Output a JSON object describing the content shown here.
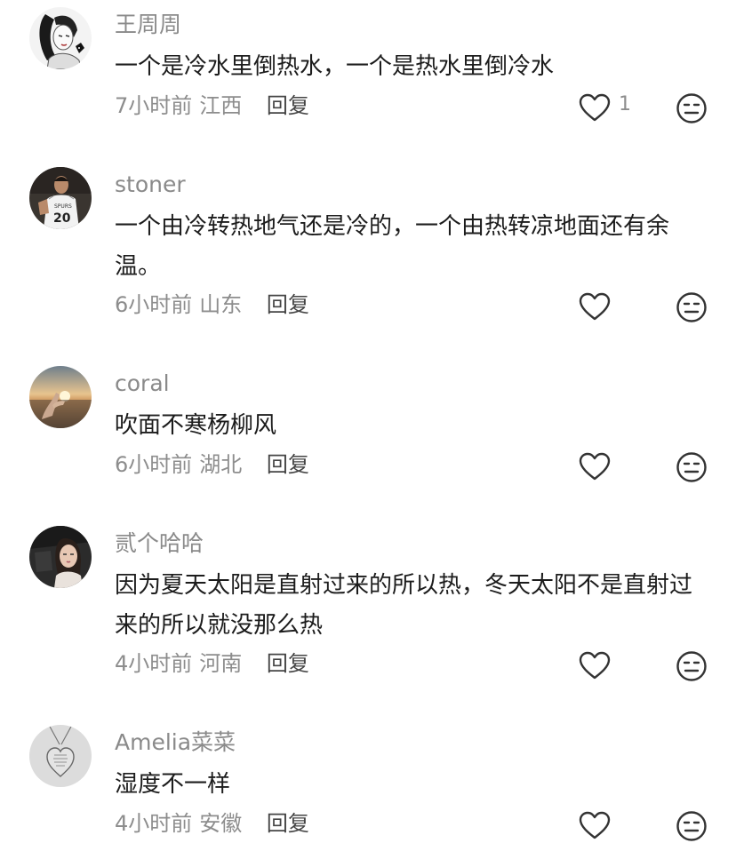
{
  "comments": [
    {
      "username": "王周周",
      "text": "一个是冷水里倒热水，一个是热水里倒冷水",
      "time": "7小时前",
      "location": "江西",
      "reply_label": "回复",
      "like_count": "1",
      "avatar_icon": "woman-illustration-avatar"
    },
    {
      "username": "stoner",
      "text": "一个由冷转热地气还是冷的，一个由热转凉地面还有余温。",
      "time": "6小时前",
      "location": "山东",
      "reply_label": "回复",
      "avatar_icon": "basketball-player-avatar"
    },
    {
      "username": "coral",
      "text": "吹面不寒杨柳风",
      "time": "6小时前",
      "location": "湖北",
      "reply_label": "回复",
      "avatar_icon": "sunset-hand-avatar"
    },
    {
      "username": "贰个哈哈",
      "text": "因为夏天太阳是直射过来的所以热，冬天太阳不是直射过来的所以就没那么热",
      "time": "4小时前",
      "location": "河南",
      "reply_label": "回复",
      "avatar_icon": "woman-car-selfie-avatar"
    },
    {
      "username": "Amelia菜菜",
      "text": "湿度不一样",
      "time": "4小时前",
      "location": "安徽",
      "reply_label": "回复",
      "avatar_icon": "heart-necklace-avatar"
    }
  ],
  "colors": {
    "username": "#8a8a8a",
    "text": "#1c1c1c",
    "meta": "#8d8d8d",
    "icon": "#333333"
  },
  "icons": {
    "like": "heart-outline-icon",
    "reaction": "neutral-face-icon"
  }
}
